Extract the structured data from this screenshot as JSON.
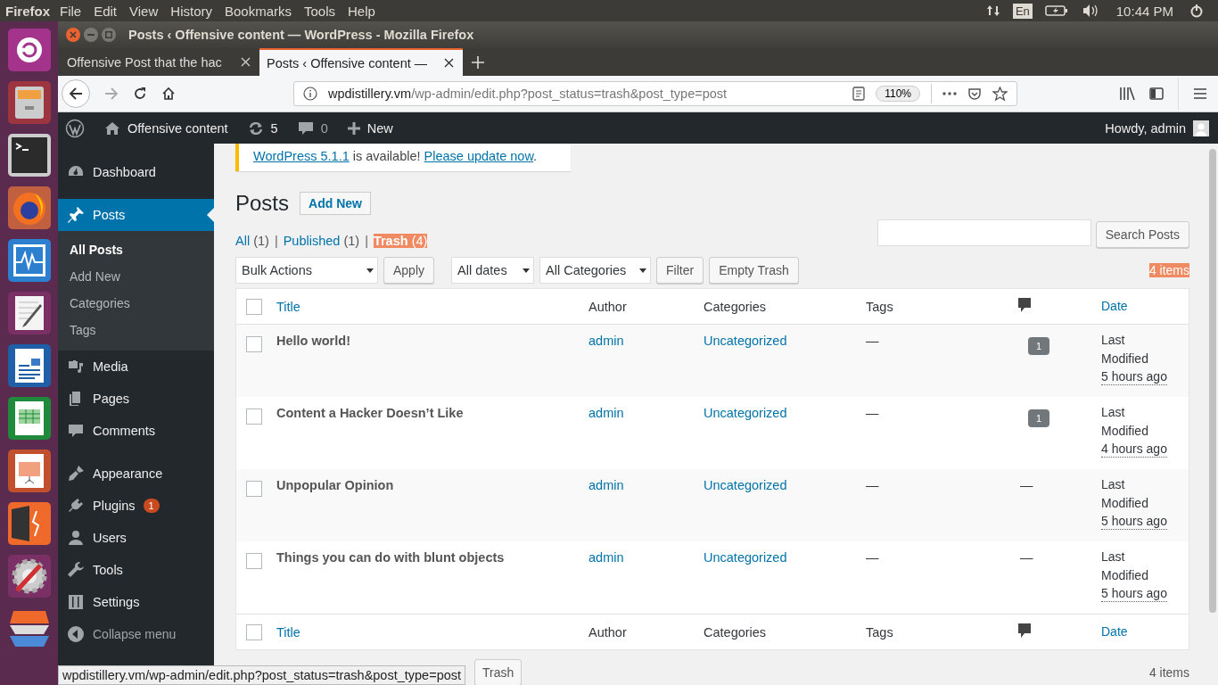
{
  "top_panel": {
    "app": "Firefox",
    "menus": [
      "File",
      "Edit",
      "View",
      "History",
      "Bookmarks",
      "Tools",
      "Help"
    ],
    "keyboard": "En",
    "clock": "10:44 PM"
  },
  "window": {
    "title": "Posts ‹ Offensive content — WordPress - Mozilla Firefox"
  },
  "tabs": [
    {
      "label": "Offensive Post that the hac",
      "selected": false
    },
    {
      "label": "Posts ‹ Offensive content —",
      "selected": true
    }
  ],
  "url": {
    "host": "wpdistillery.vm",
    "path": "/wp-admin/edit.php?post_status=trash&post_type=post",
    "zoom": "110%"
  },
  "admin_bar": {
    "site": "Offensive content",
    "updates": "5",
    "comments": "0",
    "new": "New",
    "greeting": "Howdy, admin"
  },
  "notice": {
    "link": "WordPress 5.1.1",
    "text": " is available! ",
    "action": "Please update now",
    "end": "."
  },
  "menu": [
    {
      "label": "Dashboard",
      "kind": "dashboard",
      "selected": false
    },
    {
      "label": "Posts",
      "kind": "pin",
      "selected": true,
      "children": [
        {
          "label": "All Posts",
          "selected": true
        },
        {
          "label": "Add New",
          "selected": false
        },
        {
          "label": "Categories",
          "selected": false
        },
        {
          "label": "Tags",
          "selected": false
        }
      ]
    },
    {
      "label": "Media",
      "kind": "media",
      "selected": false
    },
    {
      "label": "Pages",
      "kind": "pages",
      "selected": false
    },
    {
      "label": "Comments",
      "kind": "comments",
      "selected": false
    },
    {
      "label": "Appearance",
      "kind": "appearance",
      "selected": false,
      "gap_before": true
    },
    {
      "label": "Plugins",
      "kind": "plugins",
      "selected": false,
      "badge": "1"
    },
    {
      "label": "Users",
      "kind": "users",
      "selected": false
    },
    {
      "label": "Tools",
      "kind": "tools",
      "selected": false
    },
    {
      "label": "Settings",
      "kind": "settings",
      "selected": false
    },
    {
      "label": "Collapse menu",
      "kind": "collapse",
      "selected": false
    }
  ],
  "page": {
    "title": "Posts",
    "add_new": "Add New"
  },
  "views": [
    {
      "label": "All",
      "count": "(1)",
      "selected": false,
      "highlighted": false,
      "separator": "|"
    },
    {
      "label": "Published",
      "count": "(1)",
      "selected": false,
      "highlighted": false,
      "separator": "|"
    },
    {
      "label": "Trash",
      "count": "(4)",
      "selected": true,
      "highlighted": true
    }
  ],
  "search": {
    "button": "Search Posts"
  },
  "tablenav": {
    "bulk": "Bulk Actions",
    "apply": "Apply",
    "dates": "All dates",
    "categories": "All Categories",
    "filter": "Filter",
    "empty": "Empty Trash",
    "count": "4 items",
    "count_highlighted": true
  },
  "header_checked": false,
  "columns": [
    {
      "label": "Title",
      "kind": "sortable"
    },
    {
      "label": "Author",
      "kind": "plain"
    },
    {
      "label": "Categories",
      "kind": "plain"
    },
    {
      "label": "Tags",
      "kind": "plain"
    },
    {
      "kind": "comments"
    },
    {
      "label": "Date",
      "kind": "sortable"
    }
  ],
  "rows": [
    {
      "checked": false,
      "title": "Hello world!",
      "author": "admin",
      "categories": "Uncategorized",
      "tags": "—",
      "comments": "1",
      "has_comments": true,
      "status": "Last Modified",
      "date": "5 hours ago"
    },
    {
      "checked": false,
      "title": "Content a Hacker Doesn’t Like",
      "author": "admin",
      "categories": "Uncategorized",
      "tags": "—",
      "comments": "1",
      "has_comments": true,
      "status": "Last Modified",
      "date": "4 hours ago"
    },
    {
      "checked": false,
      "title": "Unpopular Opinion",
      "author": "admin",
      "categories": "Uncategorized",
      "tags": "—",
      "comments": "—",
      "has_comments": false,
      "status": "Last Modified",
      "date": "5 hours ago"
    },
    {
      "checked": false,
      "title": "Things you can do with blunt objects",
      "author": "admin",
      "categories": "Uncategorized",
      "tags": "—",
      "comments": "—",
      "has_comments": false,
      "status": "Last Modified",
      "date": "5 hours ago"
    }
  ],
  "footer_checked": false,
  "footer_columns": [
    {
      "label": "Title",
      "kind": "sortable"
    },
    {
      "label": "Author",
      "kind": "plain"
    },
    {
      "label": "Categories",
      "kind": "plain"
    },
    {
      "label": "Tags",
      "kind": "plain"
    },
    {
      "kind": "comments"
    },
    {
      "label": "Date",
      "kind": "sortable"
    }
  ],
  "bottom_nav": {
    "button_fragment": "Trash",
    "count": "4 items"
  },
  "status_url": "wpdistillery.vm/wp-admin/edit.php?post_status=trash&post_type=post"
}
